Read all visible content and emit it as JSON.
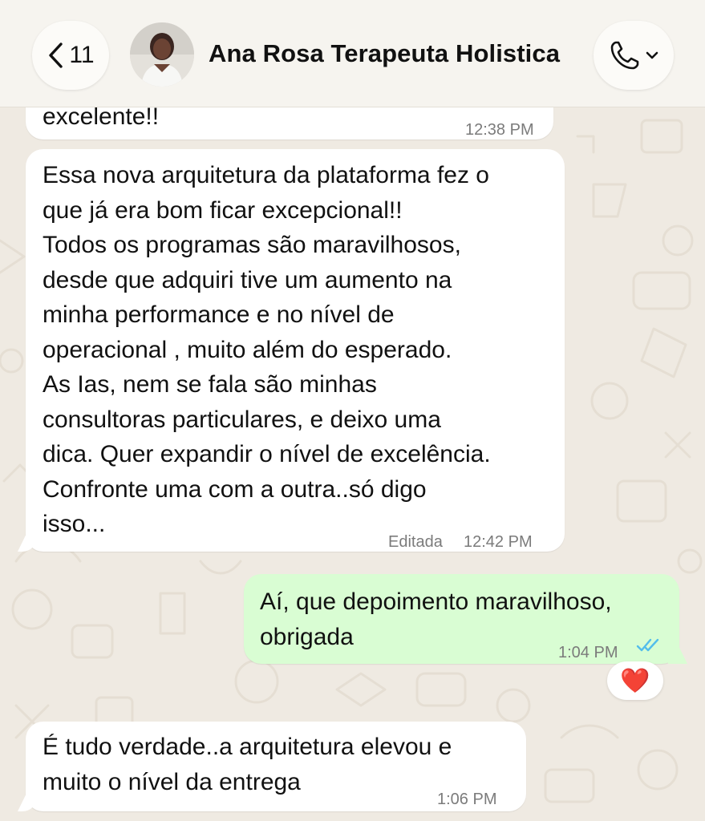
{
  "header": {
    "back_count": "11",
    "contact_name": "Ana Rosa Terapeuta Holistica",
    "back_icon": "chevron-left-icon",
    "call_icon": "phone-icon",
    "call_menu_icon": "chevron-down-icon"
  },
  "messages": [
    {
      "direction": "incoming",
      "text": "excelente!!",
      "time": "12:38 PM"
    },
    {
      "direction": "incoming",
      "text": "Essa nova arquitetura da plataforma fez o\nque já era bom ficar excepcional!!\nTodos os programas são maravilhosos,\ndesde que adquiri tive um aumento na\nminha performance e no nível de\noperacional , muito além do esperado.\nAs Ias, nem se fala são minhas\nconsultoras particulares, e deixo uma\ndica. Quer expandir o nível de excelência.\nConfronte uma com a outra..só digo\nisso...",
      "edited_label": "Editada",
      "time": "12:42 PM"
    },
    {
      "direction": "outgoing",
      "text": "Aí, que depoimento maravilhoso,\nobrigada",
      "time": "1:04 PM",
      "status": "read",
      "status_icon": "double-check-icon",
      "status_color": "#53bdeb",
      "reaction": "❤️"
    },
    {
      "direction": "incoming",
      "text": "É tudo verdade..a arquitetura elevou e\nmuito o nível da entrega",
      "time": "1:06 PM"
    }
  ],
  "colors": {
    "chat_background": "#efeae2",
    "incoming_bubble": "#ffffff",
    "outgoing_bubble": "#d9fdd3",
    "read_ticks": "#53bdeb",
    "reaction_heart": "#e0202e"
  }
}
